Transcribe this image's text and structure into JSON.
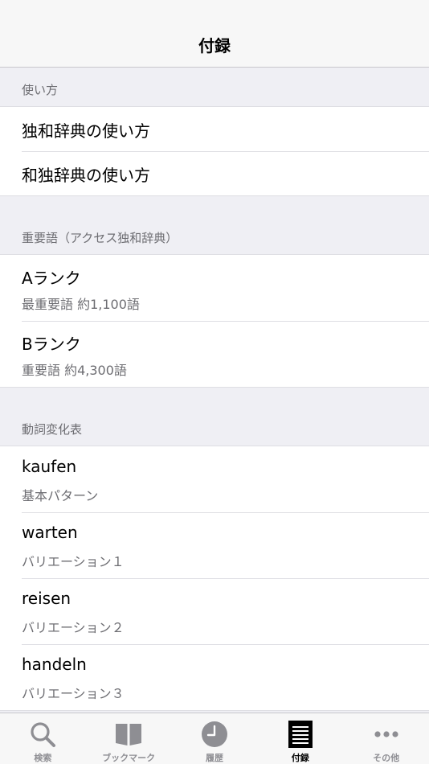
{
  "nav": {
    "title": "付録"
  },
  "sections": [
    {
      "header": "使い方",
      "items": [
        {
          "title": "独和辞典の使い方"
        },
        {
          "title": "和独辞典の使い方"
        }
      ]
    },
    {
      "header": "重要語（アクセス独和辞典）",
      "items": [
        {
          "title": "Aランク",
          "subtitle": "最重要語 約1,100語"
        },
        {
          "title": "Bランク",
          "subtitle": "重要語 約4,300語"
        }
      ]
    },
    {
      "header": "動詞変化表",
      "items": [
        {
          "title": "kaufen",
          "subtitle": "基本パターン"
        },
        {
          "title": "warten",
          "subtitle": "バリエーション１"
        },
        {
          "title": "reisen",
          "subtitle": "バリエーション２"
        },
        {
          "title": "handeln",
          "subtitle": "バリエーション３"
        }
      ]
    }
  ],
  "tabs": [
    {
      "label": "検索",
      "icon": "search-icon"
    },
    {
      "label": "ブックマーク",
      "icon": "book-icon"
    },
    {
      "label": "履歴",
      "icon": "clock-icon"
    },
    {
      "label": "付録",
      "icon": "list-icon",
      "active": true
    },
    {
      "label": "その他",
      "icon": "more-icon"
    }
  ],
  "colors": {
    "active": "#000000",
    "inactive": "#8e8e93",
    "background": "#efeff4"
  }
}
